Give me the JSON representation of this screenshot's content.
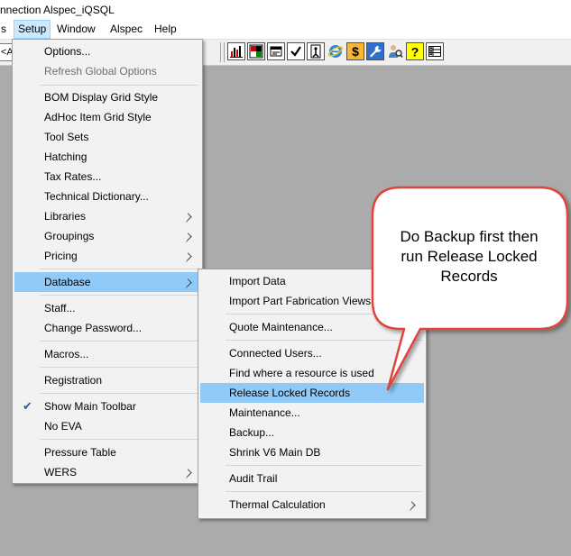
{
  "window": {
    "title": "nnection Alspec_iQSQL"
  },
  "menubar": {
    "items": [
      "s",
      "Setup",
      "Window",
      "Alspec",
      "Help"
    ]
  },
  "toolbar": {
    "combo_value": "<A",
    "buttons": [
      "chart-icon",
      "color-grid-icon",
      "properties-icon",
      "checkmark-icon",
      "exit-door-icon",
      "browser-icon",
      "dollar-icon",
      "wrench-icon",
      "user-search-icon",
      "help-icon",
      "grid-list-icon"
    ]
  },
  "setup_menu": {
    "items": [
      "Options...",
      "Refresh Global Options",
      "BOM Display Grid Style",
      "AdHoc Item Grid Style",
      "Tool Sets",
      "Hatching",
      "Tax Rates...",
      "Technical Dictionary...",
      "Libraries",
      "Groupings",
      "Pricing",
      "Database",
      "Staff...",
      "Change Password...",
      "Macros...",
      "Registration",
      "Show Main Toolbar",
      "No EVA",
      "Pressure Table",
      "WERS"
    ]
  },
  "database_menu": {
    "items": [
      "Import Data",
      "Import Part Fabrication Views...",
      "Quote Maintenance...",
      "Connected Users...",
      "Find where a resource is used",
      "Release Locked Records",
      "Maintenance...",
      "Backup...",
      "Shrink V6 Main DB",
      "Audit Trail",
      "Thermal Calculation"
    ]
  },
  "callout": {
    "line1": "Do Backup first then",
    "line2": "run Release Locked",
    "line3": "Records",
    "border_color": "#e0443e"
  }
}
